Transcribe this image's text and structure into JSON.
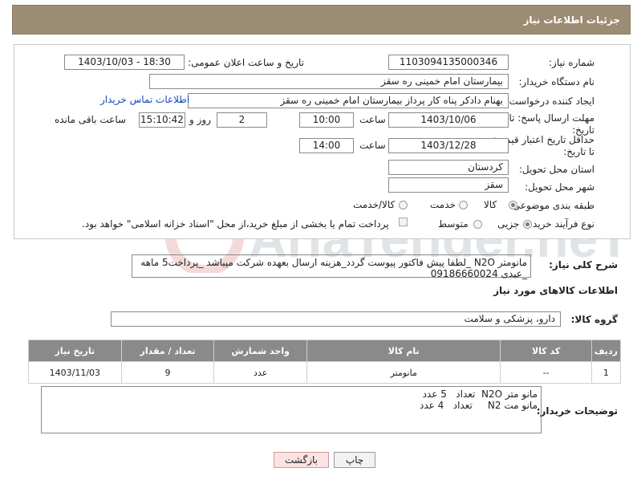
{
  "header": {
    "title": "جزئیات اطلاعات نیاز"
  },
  "form": {
    "need_number_label": "شماره نیاز:",
    "need_number": "1103094135000346",
    "announce_label": "تاریخ و ساعت اعلان عمومی:",
    "announce_value": "1403/10/03 - 18:30",
    "buyer_org_label": "نام دستگاه خریدار:",
    "buyer_org": "بیمارستان امام خمینی  ره  سقز",
    "creator_label": "ایجاد کننده درخواست:",
    "creator": "بهنام دادکر پناه کار پرداز بیمارستان امام خمینی  ره  سقز",
    "contact_link": "اطلاعات تماس خریدار",
    "deadline_label": "مهلت ارسال پاسخ: تا تاریخ:",
    "deadline_date": "1403/10/06",
    "time_label": "ساعت",
    "deadline_time": "10:00",
    "days_value": "2",
    "days_label": "روز و",
    "remaining_time": "15:10:42",
    "remaining_label": "ساعت باقی مانده",
    "validity_label": "حداقل تاریخ اعتبار قیمت: تا تاریخ:",
    "validity_date": "1403/12/28",
    "validity_time_label": "ساعت",
    "validity_time": "14:00",
    "province_label": "استان محل تحویل:",
    "province": "کردستان",
    "city_label": "شهر محل تحویل:",
    "city": "سقز",
    "category_label": "طبقه بندی موضوعی:",
    "category_options": [
      "کالا",
      "خدمت",
      "کالا/خدمت"
    ],
    "process_label": "نوع فرآیند خرید :",
    "process_options": [
      "جزیی",
      "متوسط"
    ],
    "payment_note": "پرداخت تمام یا بخشی از مبلغ خرید،از محل \"اسناد خزانه اسلامی\" خواهد بود."
  },
  "summary": {
    "label": "شرح کلی نیاز:",
    "text": "مانومتر N2O _لطفا پیش فاکتور  پیوست گردد_هزینه ارسال بعهده شرکت میباشد _پرداخت5 ماهه _عبدی 09186660024"
  },
  "goods": {
    "section_title": "اطلاعات کالاهای مورد نیاز",
    "group_label": "گروه کالا:",
    "group_value": "دارو، پزشکی و سلامت",
    "columns": [
      "ردیف",
      "کد کالا",
      "نام کالا",
      "واحد شمارش",
      "تعداد / مقدار",
      "تاریخ نیاز"
    ],
    "rows": [
      {
        "row": "1",
        "code": "--",
        "name": "مانومتر",
        "unit": "عدد",
        "qty": "9",
        "date": "1403/11/03"
      }
    ]
  },
  "buyer_notes": {
    "label": "توضیحات خریدار:",
    "line1": "مانو متر N2O  تعداد   5 عدد",
    "line2": "مانو مت N2     تعداد   4 عدد"
  },
  "buttons": {
    "print": "چاپ",
    "back": "بازگشت"
  },
  "colors": {
    "header_bg": "#9c8c73",
    "table_header_bg": "#8a8a8a",
    "link": "#1a47b8",
    "back_btn_bg": "#fbe3e3"
  },
  "watermark": {
    "text": "AriaTender.neT"
  }
}
